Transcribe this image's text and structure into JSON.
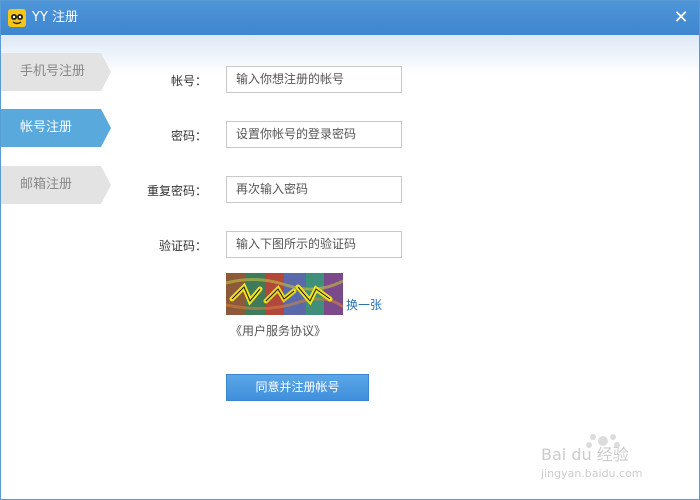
{
  "window": {
    "title": "YY 注册"
  },
  "tabs": [
    {
      "label": "手机号注册",
      "active": false
    },
    {
      "label": "帐号注册",
      "active": true
    },
    {
      "label": "邮箱注册",
      "active": false
    }
  ],
  "form": {
    "account": {
      "label": "帐号：",
      "placeholder": "输入你想注册的帐号"
    },
    "password": {
      "label": "密码：",
      "placeholder": "设置你帐号的登录密码"
    },
    "confirm": {
      "label": "重复密码：",
      "placeholder": "再次输入密码"
    },
    "captcha": {
      "label": "验证码：",
      "placeholder": "输入下图所示的验证码"
    }
  },
  "captcha_refresh": "换一张",
  "agreement": "《用户服务协议》",
  "submit": "同意并注册帐号",
  "watermark": {
    "logo": "Bai du 经验",
    "url": "jingyan.baidu.com"
  },
  "colors": {
    "title_bar": "#4f95d8",
    "active_tab": "#5aa9dd",
    "button": "#4a9ae0"
  }
}
